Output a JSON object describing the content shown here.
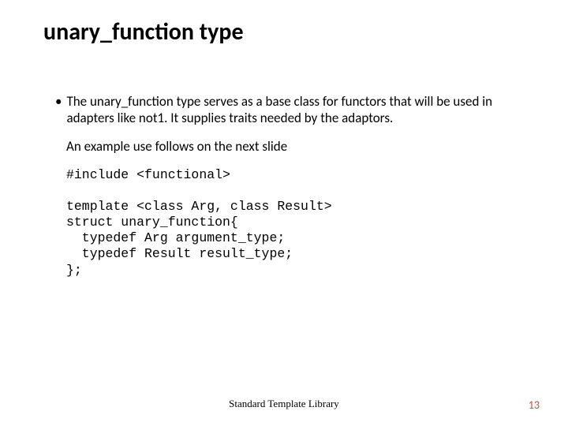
{
  "title": "unary_function type",
  "bullet": {
    "marker": "•",
    "text": "The unary_function type serves as a base class for functors that will be used in adapters like not1.  It supplies traits needed by the adaptors."
  },
  "subtext": "An example use follows on the next slide",
  "code": "#include <functional>\n\ntemplate <class Arg, class Result>\nstruct unary_function{\n  typedef Arg argument_type;\n  typedef Result result_type;\n};",
  "footer": "Standard Template Library",
  "pagenum": "13"
}
